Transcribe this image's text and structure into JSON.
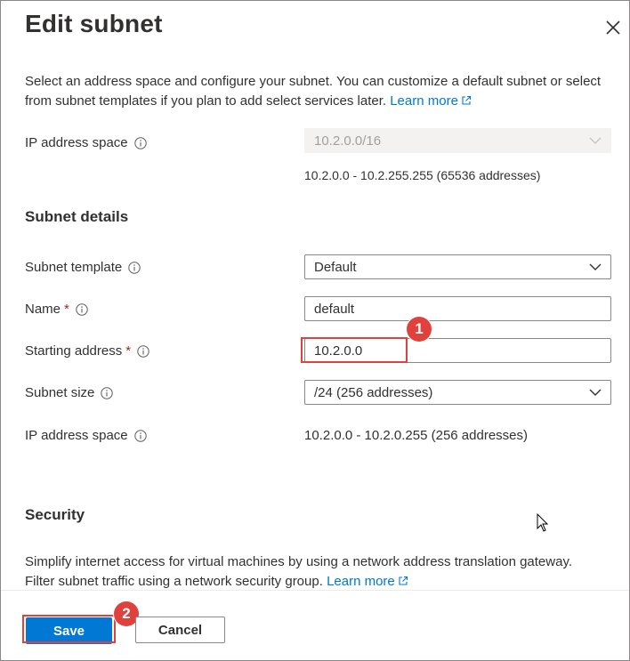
{
  "panel": {
    "title": "Edit subnet",
    "description_text": "Select an address space and configure your subnet. You can customize a default subnet or select from subnet templates if you plan to add select services later.",
    "description_link": "Learn more"
  },
  "address_space": {
    "label": "IP address space",
    "selected": "10.2.0.0/16",
    "range": "10.2.0.0 - 10.2.255.255 (65536 addresses)"
  },
  "subnet_details": {
    "heading": "Subnet details",
    "template_label": "Subnet template",
    "template_value": "Default",
    "name_label": "Name",
    "name_required": "*",
    "name_value": "default",
    "start_label": "Starting address",
    "start_required": "*",
    "start_value": "10.2.0.0",
    "size_label": "Subnet size",
    "size_value": "/24 (256 addresses)",
    "ip_space_label": "IP address space",
    "ip_space_value": "10.2.0.0 - 10.2.0.255 (256 addresses)"
  },
  "security": {
    "heading": "Security",
    "description_text": "Simplify internet access for virtual machines by using a network address translation gateway. Filter subnet traffic using a network security group.",
    "description_link": "Learn more"
  },
  "footer": {
    "save_label": "Save",
    "cancel_label": "Cancel"
  },
  "annotations": {
    "step1": "1",
    "step2": "2"
  },
  "colors": {
    "accent": "#0078d4",
    "annotation": "#e0413d",
    "required": "#a4262c"
  }
}
